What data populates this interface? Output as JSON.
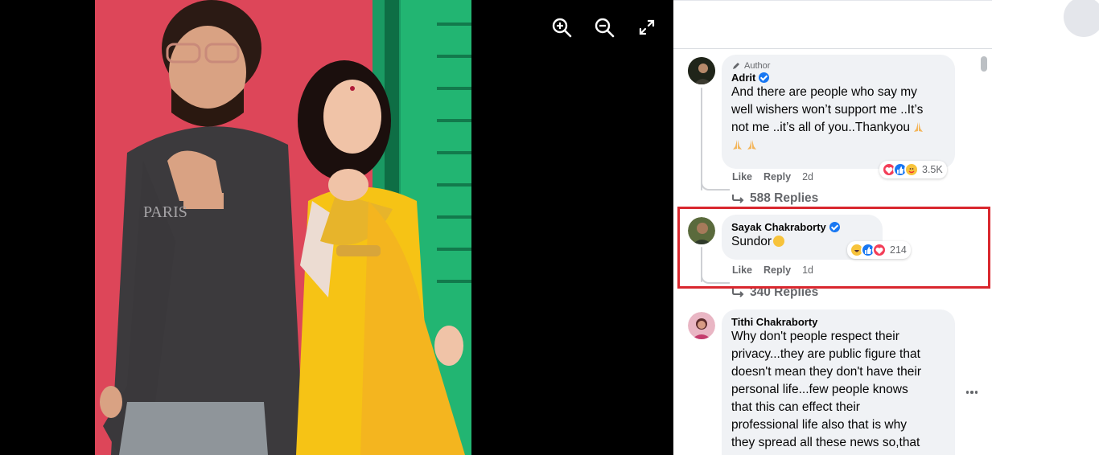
{
  "viewer": {
    "tools": [
      {
        "name": "zoom-in-icon"
      },
      {
        "name": "zoom-out-icon"
      },
      {
        "name": "fullscreen-icon"
      }
    ]
  },
  "comments": [
    {
      "author_badge": "Author",
      "name": "Adrit",
      "verified": true,
      "text_lines": [
        "And there are people who say my",
        "well wishers won’t support me ..It’s",
        "not me ..it’s all of you..Thankyou"
      ],
      "like": "Like",
      "reply": "Reply",
      "time": "2d",
      "reaction_count": "3.5K",
      "replies": "588 Replies"
    },
    {
      "name": "Sayak Chakraborty",
      "verified": true,
      "text": "Sundor",
      "like": "Like",
      "reply": "Reply",
      "time": "1d",
      "reaction_count": "214",
      "replies": "340 Replies"
    },
    {
      "name": "Tithi Chakraborty",
      "verified": false,
      "text_lines": [
        "Why don't people respect their",
        "privacy...they are public figure that",
        "doesn't mean they don't have their",
        "personal life...few people knows",
        "that this can effect their",
        "professional life also that is why",
        "they spread all these news so,that"
      ]
    }
  ],
  "colors": {
    "highlight": "#d9272e",
    "link_blue": "#1877f2",
    "bubble": "#f0f2f5"
  }
}
